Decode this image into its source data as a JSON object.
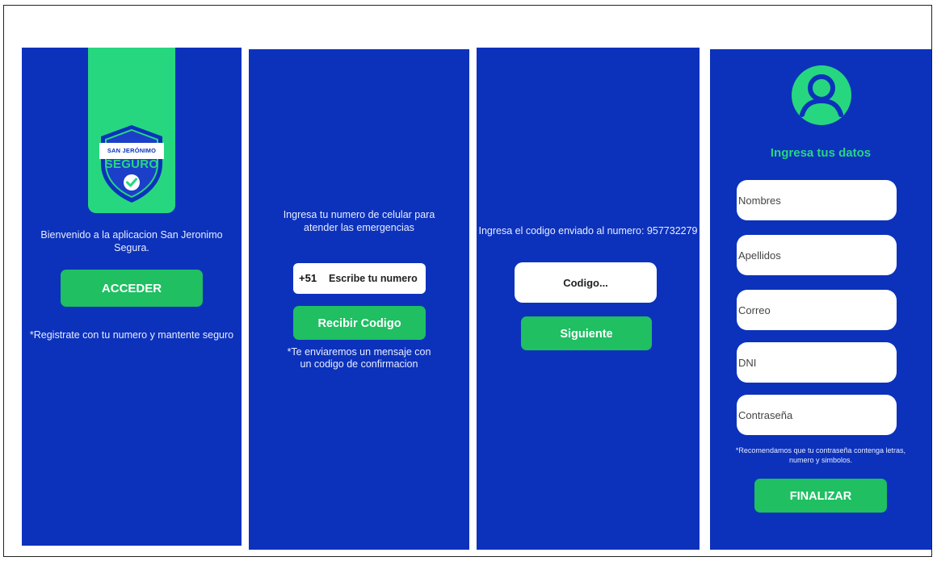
{
  "colors": {
    "background_blue": "#0c32bb",
    "accent_green": "#27d77f",
    "button_green": "#1fbf62"
  },
  "screen1": {
    "logo_top_text": "SAN JERÓNIMO",
    "logo_main_text": "SEGURO",
    "welcome": "Bienvenido a la aplicacion San Jeronimo Segura.",
    "button": "ACCEDER",
    "note": "*Registrate con tu numero y mantente seguro"
  },
  "screen2": {
    "prompt": "Ingresa tu numero de celular para atender las emergencias",
    "prefix": "+51",
    "phone_placeholder": "Escribe tu numero",
    "button": "Recibir Codigo",
    "note": "*Te enviaremos un mensaje con un codigo de confirmacion"
  },
  "screen3": {
    "prompt": "Ingresa el codigo enviado al numero: 957732279",
    "code_placeholder": "Codigo...",
    "button": "Siguiente"
  },
  "screen4": {
    "title": "Ingresa tus datos",
    "fields": [
      "Nombres",
      "Apellidos",
      "Correo",
      "DNI",
      "Contraseña"
    ],
    "note": "*Recomendamos que tu contraseña contenga letras, numero y simbolos.",
    "button": "FINALIZAR"
  }
}
